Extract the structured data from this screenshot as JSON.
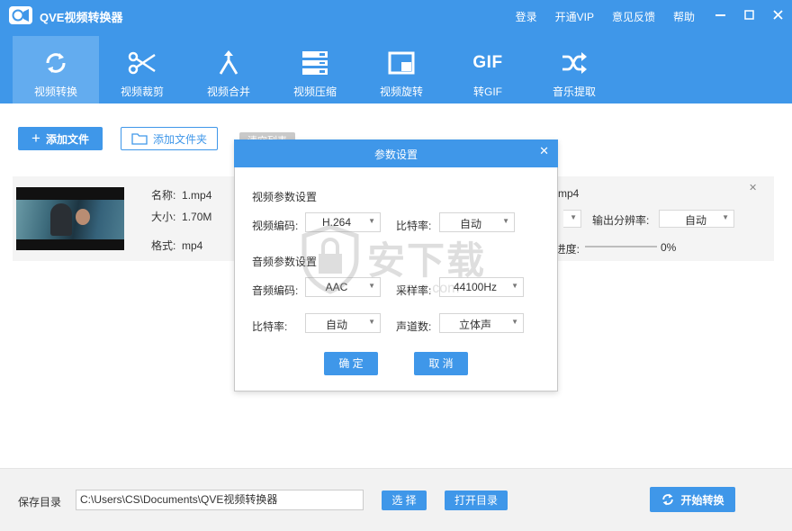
{
  "app": {
    "title": "QVE视频转换器"
  },
  "top_links": [
    "登录",
    "开通VIP",
    "意见反馈",
    "帮助"
  ],
  "window_controls": {
    "minimize": "—",
    "maximize": "□",
    "close": "✕"
  },
  "toolbar": [
    {
      "label": "视频转换",
      "icon": "refresh-icon",
      "active": true
    },
    {
      "label": "视频裁剪",
      "icon": "scissors-icon"
    },
    {
      "label": "视频合并",
      "icon": "merge-icon"
    },
    {
      "label": "视频压缩",
      "icon": "compress-icon"
    },
    {
      "label": "视频旋转",
      "icon": "rotate-icon"
    },
    {
      "label": "转GIF",
      "icon": "gif-icon",
      "icon_text": "GIF"
    },
    {
      "label": "音乐提取",
      "icon": "shuffle-icon"
    }
  ],
  "actions": {
    "add_file": "添加文件",
    "add_folder": "添加文件夹",
    "clear_list": "清空列表"
  },
  "file": {
    "name_label": "名称:",
    "name": "1.mp4",
    "size_label": "大小:",
    "size": "1.70M",
    "format_label": "格式:",
    "format": "mp4",
    "out_name": "mp4",
    "resolution_label": "输出分辨率:",
    "resolution": "自动",
    "progress_label": "进度:",
    "progress": "0%",
    "progress_value": 0
  },
  "dialog": {
    "title": "参数设置",
    "close": "✕",
    "video_section": "视频参数设置",
    "video_codec_label": "视频编码:",
    "video_codec": "H.264",
    "video_bitrate_label": "比特率:",
    "video_bitrate": "自动",
    "audio_section": "音频参数设置",
    "audio_codec_label": "音频编码:",
    "audio_codec": "AAC",
    "sample_rate_label": "采样率:",
    "sample_rate": "44100Hz",
    "audio_bitrate_label": "比特率:",
    "audio_bitrate": "自动",
    "channels_label": "声道数:",
    "channels": "立体声",
    "ok": "确 定",
    "cancel": "取 消"
  },
  "watermark": {
    "text": "安下载",
    "url": "anxz.com"
  },
  "bottom": {
    "save_dir_label": "保存目录",
    "save_path": "C:\\Users\\CS\\Documents\\QVE视频转换器",
    "choose": "选 择",
    "open_dir": "打开目录",
    "start": "开始转换"
  },
  "colors": {
    "primary": "#3f97e9",
    "active_tab": "#63acef",
    "row_bg": "#f4f4f4",
    "footer_bg": "#f2f2f2"
  }
}
